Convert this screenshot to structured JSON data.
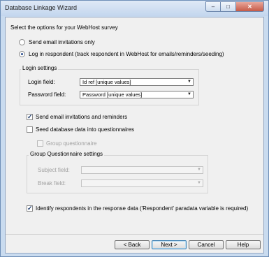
{
  "window": {
    "title": "Database Linkage Wizard"
  },
  "window_controls": {
    "minimize": "–",
    "maximize": "□",
    "close": "✕"
  },
  "heading": "Select the options for your WebHost survey",
  "options": {
    "send_only": "Send email invitations only",
    "login": "Log in respondent  (track respondent in WebHost for emails/reminders/seeding)"
  },
  "login_settings": {
    "title": "Login settings",
    "login_field_label": "Login field:",
    "login_field_value": "Id ref [unique values]",
    "password_field_label": "Password field:",
    "password_field_value": "Password [unique values]"
  },
  "checks": {
    "send_email": "Send email invitations and reminders",
    "seed_db": "Seed database data into questionnaires",
    "group_questionnaire": "Group questionnaire"
  },
  "group_settings": {
    "title": "Group Questionnaire settings",
    "subject_label": "Subject field:",
    "subject_value": "",
    "break_label": "Break field:",
    "break_value": ""
  },
  "identify": "Identify respondents in the response data ('Respondent' paradata variable is required)",
  "buttons": {
    "back": "< Back",
    "next": "Next >",
    "cancel": "Cancel",
    "help": "Help"
  }
}
